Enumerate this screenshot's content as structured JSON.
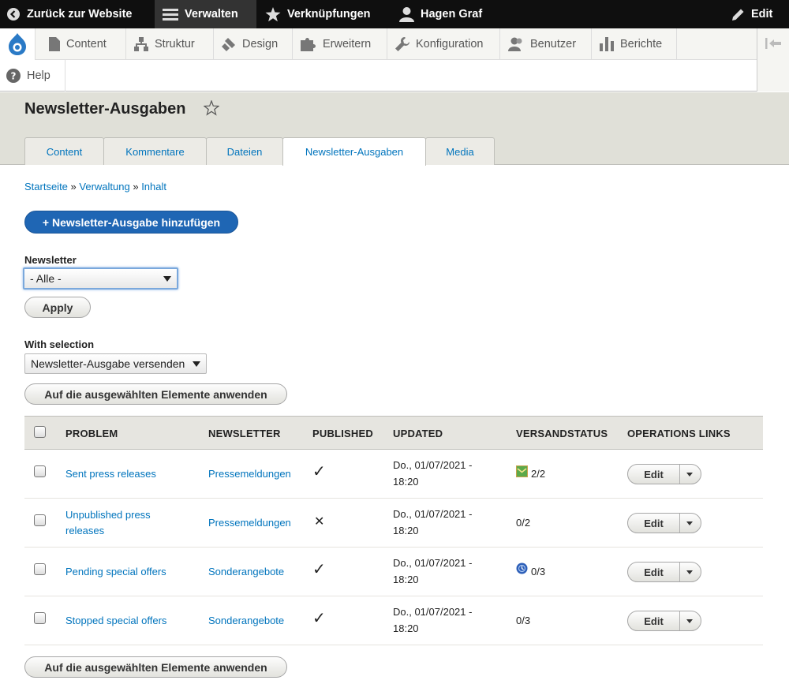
{
  "toolbar": {
    "back": "Zurück zur Website",
    "manage": "Verwalten",
    "shortcuts": "Verknüpfungen",
    "user": "Hagen Graf",
    "edit": "Edit"
  },
  "menu": {
    "items": [
      "Content",
      "Struktur",
      "Design",
      "Erweitern",
      "Konfiguration",
      "Benutzer",
      "Berichte"
    ],
    "help": "Help"
  },
  "page": {
    "title": "Newsletter-Ausgaben",
    "tabs": [
      "Content",
      "Kommentare",
      "Dateien",
      "Newsletter-Ausgaben",
      "Media"
    ],
    "breadcrumb": [
      "Startseite",
      "Verwaltung",
      "Inhalt"
    ],
    "add_button": "+ Newsletter-Ausgabe hinzufügen"
  },
  "filter": {
    "label": "Newsletter",
    "value": "- Alle -",
    "apply": "Apply"
  },
  "bulk": {
    "label": "With selection",
    "value": "Newsletter-Ausgabe versenden",
    "apply": "Auf die ausgewählten Elemente anwenden"
  },
  "table": {
    "headers": [
      "PROBLEM",
      "NEWSLETTER",
      "PUBLISHED",
      "UPDATED",
      "VERSANDSTATUS",
      "OPERATIONS LINKS"
    ],
    "rows": [
      {
        "problem": "Sent press releases",
        "problem2": "",
        "newsletter": "Pressemeldungen",
        "published": "✓",
        "updated1": "Do., 01/07/2021 -",
        "updated2": "18:20",
        "status": "2/2",
        "status_icon": "sent-icon",
        "op": "Edit"
      },
      {
        "problem": "Unpublished press",
        "problem2": "releases",
        "newsletter": "Pressemeldungen",
        "published": "✕",
        "updated1": "Do., 01/07/2021 -",
        "updated2": "18:20",
        "status": "0/2",
        "status_icon": "",
        "op": "Edit"
      },
      {
        "problem": "Pending special offers",
        "problem2": "",
        "newsletter": "Sonderangebote",
        "published": "✓",
        "updated1": "Do., 01/07/2021 -",
        "updated2": "18:20",
        "status": "0/3",
        "status_icon": "pending-icon",
        "op": "Edit"
      },
      {
        "problem": "Stopped special offers",
        "problem2": "",
        "newsletter": "Sonderangebote",
        "published": "✓",
        "updated1": "Do., 01/07/2021 -",
        "updated2": "18:20",
        "status": "0/3",
        "status_icon": "",
        "op": "Edit"
      }
    ]
  },
  "colors": {
    "toolbar_bg": "#0f0f0f",
    "primary": "#1f66b4",
    "link": "#0074bd"
  }
}
